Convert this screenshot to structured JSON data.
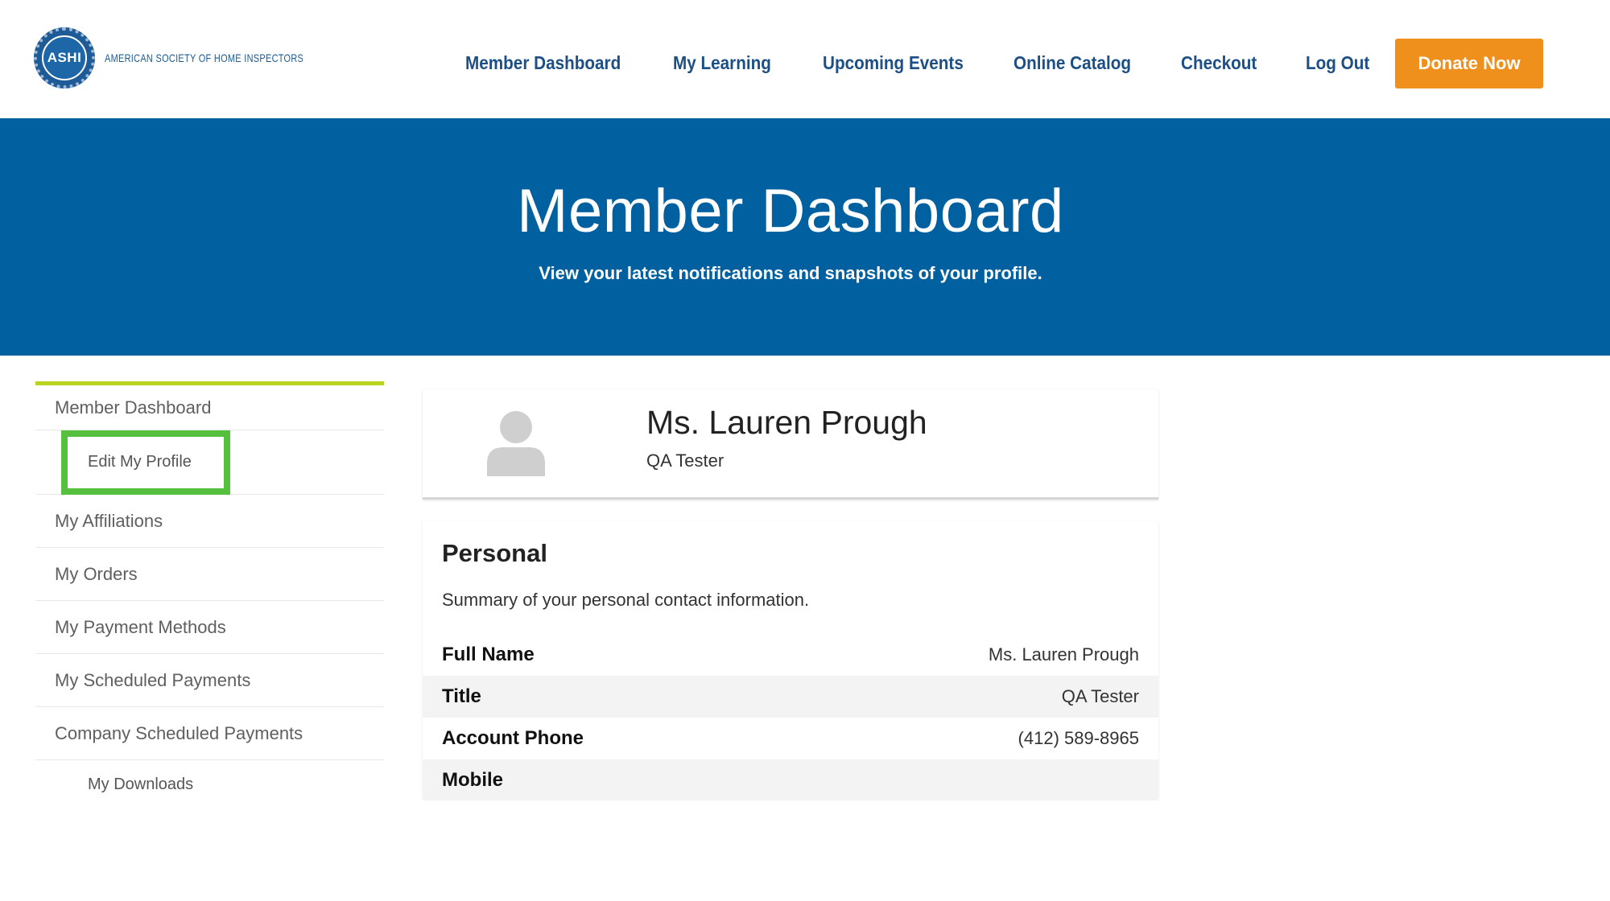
{
  "logo": {
    "seal_text": "ASHI",
    "org_name": "AMERICAN SOCIETY OF HOME INSPECTORS"
  },
  "nav": {
    "items": [
      {
        "label": "Member Dashboard"
      },
      {
        "label": "My Learning"
      },
      {
        "label": "Upcoming Events"
      },
      {
        "label": "Online Catalog"
      },
      {
        "label": "Checkout"
      },
      {
        "label": "Log Out"
      }
    ],
    "donate_label": "Donate Now"
  },
  "hero": {
    "title": "Member Dashboard",
    "subtitle": "View your latest notifications and snapshots of your profile."
  },
  "sidebar": {
    "items": [
      {
        "label": "Member Dashboard"
      },
      {
        "label": "Edit My Profile"
      },
      {
        "label": "My Affiliations"
      },
      {
        "label": "My Orders"
      },
      {
        "label": "My Payment Methods"
      },
      {
        "label": "My Scheduled Payments"
      },
      {
        "label": "Company Scheduled Payments"
      },
      {
        "label": "My Downloads"
      }
    ]
  },
  "profile": {
    "name": "Ms. Lauren Prough",
    "title": "QA Tester"
  },
  "personal": {
    "heading": "Personal",
    "description": "Summary of your personal contact information.",
    "rows": [
      {
        "label": "Full Name",
        "value": "Ms. Lauren Prough"
      },
      {
        "label": "Title",
        "value": "QA Tester"
      },
      {
        "label": "Account Phone",
        "value": "(412) 589-8965"
      },
      {
        "label": "Mobile",
        "value": ""
      }
    ]
  },
  "colors": {
    "brand_blue": "#01609f",
    "nav_text": "#1c4f86",
    "donate": "#f0901c",
    "sidebar_accent": "#b9d31e",
    "highlight": "#55c03d"
  }
}
